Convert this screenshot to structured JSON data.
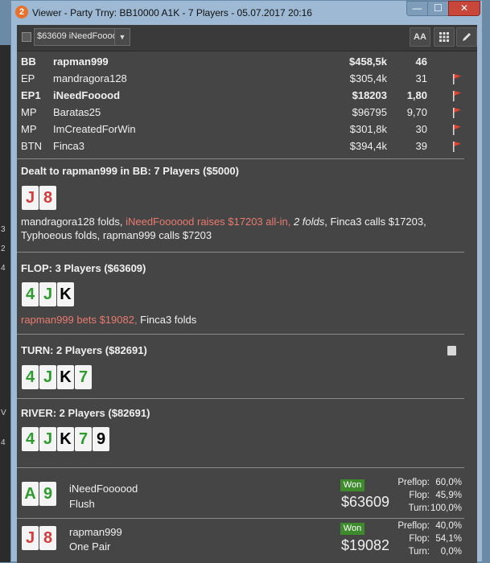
{
  "window": {
    "title": "Viewer - Party Trny: BB10000 A1K - 7 Players - 05.07.2017 20:16",
    "min_glyph": "—",
    "max_glyph": "☐",
    "close_glyph": "✕"
  },
  "toolbar": {
    "player_select": "$63609 iNeedFoooo",
    "font_button": "AA"
  },
  "players": [
    {
      "pos": "BB",
      "name": "rapman999",
      "stack": "$458,5k",
      "bb": "46",
      "bold": true
    },
    {
      "pos": "EP",
      "name": "mandragora128",
      "stack": "$305,4k",
      "bb": "31"
    },
    {
      "pos": "EP1",
      "name": "iNeedFooood",
      "stack": "$18203",
      "bb": "1,80",
      "bold": true
    },
    {
      "pos": "MP",
      "name": "Baratas25",
      "stack": "$96795",
      "bb": "9,70"
    },
    {
      "pos": "MP",
      "name": "ImCreatedForWin",
      "stack": "$301,8k",
      "bb": "30"
    },
    {
      "pos": "BTN",
      "name": "Finca3",
      "stack": "$394,4k",
      "bb": "39"
    }
  ],
  "preflop": {
    "title": "Dealt to rapman999 in BB: 7 Players ($5000)",
    "cards": [
      {
        "rank": "J",
        "c": "r"
      },
      {
        "rank": "8",
        "c": "r"
      }
    ],
    "a1": "mandragora128 folds, ",
    "a2": "iNeedFoooood raises $17203 all-in, ",
    "a3": "2 folds",
    "a4": ", Finca3 calls $17203,",
    "a5": "Typhoeous folds, rapman999 calls $7203"
  },
  "flop": {
    "title": "FLOP: 3 Players ($63609)",
    "cards": [
      {
        "rank": "4",
        "c": "g"
      },
      {
        "rank": "J",
        "c": "g"
      },
      {
        "rank": "K",
        "c": "k"
      }
    ],
    "a1": "rapman999 bets $19082, ",
    "a2": "Finca3 folds"
  },
  "turn": {
    "title": "TURN: 2 Players ($82691)",
    "cards": [
      {
        "rank": "4",
        "c": "g"
      },
      {
        "rank": "J",
        "c": "g"
      },
      {
        "rank": "K",
        "c": "k"
      },
      {
        "rank": "7",
        "c": "g"
      }
    ]
  },
  "river": {
    "title": "RIVER: 2 Players ($82691)",
    "cards": [
      {
        "rank": "4",
        "c": "g"
      },
      {
        "rank": "J",
        "c": "g"
      },
      {
        "rank": "K",
        "c": "k"
      },
      {
        "rank": "7",
        "c": "g"
      },
      {
        "rank": "9",
        "c": "k"
      }
    ]
  },
  "results": [
    {
      "cards": [
        {
          "rank": "A",
          "c": "g"
        },
        {
          "rank": "9",
          "c": "g"
        }
      ],
      "name": "iNeedFoooood",
      "hand": "Flush",
      "won_label": "Won",
      "amount": "$63609",
      "stats": [
        {
          "label": "Preflop:",
          "value": "60,0%"
        },
        {
          "label": "Flop:",
          "value": "45,9%"
        },
        {
          "label": "Turn:",
          "value": "100,0%"
        }
      ]
    },
    {
      "cards": [
        {
          "rank": "J",
          "c": "r"
        },
        {
          "rank": "8",
          "c": "r"
        }
      ],
      "name": "rapman999",
      "hand": "One Pair",
      "won_label": "Won",
      "amount": "$19082",
      "stats": [
        {
          "label": "Preflop:",
          "value": "40,0%"
        },
        {
          "label": "Flop:",
          "value": "54,1%"
        },
        {
          "label": "Turn:",
          "value": "0,0%"
        }
      ]
    }
  ],
  "background_fragments": [
    "3",
    "2",
    "4",
    "V",
    "4"
  ],
  "colors": {
    "won_badge": "#3e8b2e",
    "action_red": "#ea7a6f",
    "card_red": "#d13c3c",
    "card_green": "#2f9b2f"
  }
}
